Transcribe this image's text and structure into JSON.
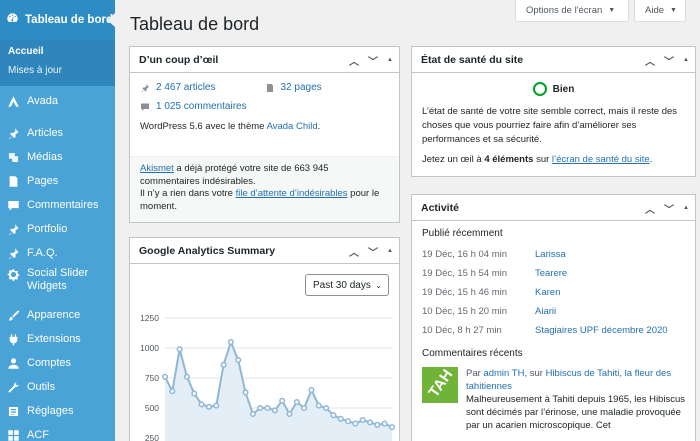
{
  "top_buttons": {
    "screen_options": "Options de l'écran",
    "help": "Aide"
  },
  "page_title": "Tableau de bord",
  "sidebar": {
    "header": "Tableau de bord",
    "sub": [
      "Accueil",
      "Mises à jour"
    ],
    "items": [
      {
        "label": "Avada",
        "icon": "avada-icon"
      },
      {
        "label": "Articles",
        "icon": "pin-icon"
      },
      {
        "label": "Médias",
        "icon": "media-icon"
      },
      {
        "label": "Pages",
        "icon": "page-icon"
      },
      {
        "label": "Commentaires",
        "icon": "comment-icon"
      },
      {
        "label": "Portfolio",
        "icon": "pin-icon"
      },
      {
        "label": "F.A.Q.",
        "icon": "pin-icon"
      },
      {
        "label": "Social Slider Widgets",
        "icon": "gear-icon"
      },
      {
        "label": "Apparence",
        "icon": "brush-icon"
      },
      {
        "label": "Extensions",
        "icon": "plugin-icon"
      },
      {
        "label": "Comptes",
        "icon": "user-icon"
      },
      {
        "label": "Outils",
        "icon": "wrench-icon"
      },
      {
        "label": "Réglages",
        "icon": "settings-icon"
      },
      {
        "label": "ACF",
        "icon": "grid-icon"
      }
    ]
  },
  "glance": {
    "title": "D’un coup d’œil",
    "articles": "2 467 articles",
    "pages": "32 pages",
    "comments": "1 025 commentaires",
    "wp_version_prefix": "WordPress 5.6 avec le thème ",
    "theme": "Avada Child",
    "wp_version_suffix": ".",
    "akismet_link": "Akismet",
    "akismet_text": " a déjà protégé votre site de 663 945 commentaires indésirables.",
    "queue_prefix": "Il n’y a rien dans votre ",
    "queue_link": "file d’attente d’indésirables",
    "queue_suffix": " pour le moment."
  },
  "ga": {
    "title": "Google Analytics Summary",
    "range": "Past 30 days"
  },
  "health": {
    "title": "État de santé du site",
    "status": "Bien",
    "text": "L’état de santé de votre site semble correct, mais il reste des choses que vous pourriez faire afin d’améliorer ses performances et sa sécurité.",
    "check_prefix": "Jetez un œil à ",
    "check_count": "4 éléments",
    "check_mid": " sur ",
    "check_link": "l’écran de santé du site",
    "check_suffix": "."
  },
  "activity": {
    "title": "Activité",
    "published_heading": "Publié récemment",
    "rows": [
      {
        "date": "19 Déc, 16 h 04 min",
        "title": "Larissa"
      },
      {
        "date": "19 Déc, 15 h 54 min",
        "title": "Tearere"
      },
      {
        "date": "19 Déc, 15 h 46 min",
        "title": "Karen"
      },
      {
        "date": "10 Déc, 15 h 20 min",
        "title": "Aiarii"
      },
      {
        "date": "10 Déc, 8 h 27 min",
        "title": "Stagiaires UPF décembre 2020"
      }
    ],
    "comments_heading": "Commentaires récents",
    "comment": {
      "avatar_text": "TAH",
      "by": "Par ",
      "author": "admin TH",
      "on": ", sur ",
      "post": "Hibiscus de Tahiti, la fleur des tahitiennes",
      "text": "Malheureusement à Tahiti depuis 1965, les Hibiscus sont décimés par l’érinose, une maladie provoquée par un acarien microscopique. Cet"
    }
  },
  "chart_data": {
    "type": "line",
    "title": "",
    "xlabel": "",
    "ylabel": "",
    "y_ticks": [
      250,
      500,
      750,
      1000,
      1250
    ],
    "ylim": [
      150,
      1350
    ],
    "x": [
      1,
      2,
      3,
      4,
      5,
      6,
      7,
      8,
      9,
      10,
      11,
      12,
      13,
      14,
      15,
      16,
      17,
      18,
      19,
      20,
      21,
      22,
      23,
      24,
      25,
      26,
      27,
      28,
      29,
      30
    ],
    "values": [
      760,
      640,
      990,
      760,
      620,
      530,
      510,
      520,
      860,
      1050,
      900,
      630,
      450,
      500,
      500,
      480,
      560,
      450,
      550,
      500,
      650,
      520,
      500,
      440,
      410,
      390,
      370,
      400,
      380,
      360,
      370,
      340
    ],
    "series_color": "#8fb8d6"
  }
}
